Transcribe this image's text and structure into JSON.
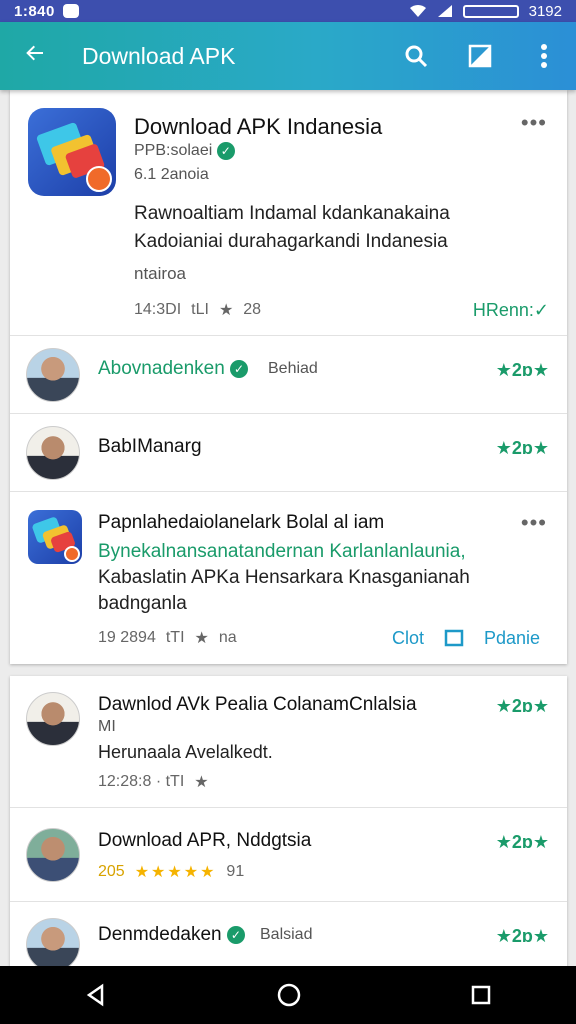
{
  "status": {
    "time": "1:840",
    "right_text": "3192"
  },
  "appbar": {
    "title": "Download APK"
  },
  "header_app": {
    "title": "Download APK Indanesia",
    "developer": "PPB:solaei",
    "version": "6.1 2anoia",
    "description": [
      "Rawnoaltiam Indamal kdankanakaina",
      "Kadoianiai durahagarkandi Indanesia"
    ],
    "tag": "ntairoa",
    "meta_date": "14:3DI",
    "meta_sep": "tLI",
    "meta_rating": "28",
    "action": "HRenn:✓"
  },
  "reviewers": [
    {
      "name": "Abovnadenken",
      "tag": "Behiad",
      "rating": "★2ɒ★"
    },
    {
      "name": "BabIManarg",
      "rating": "★2ɒ★"
    }
  ],
  "post": {
    "title": "Papnlahedaiolanelark Bolal al iam",
    "lines": [
      "Bynekalnansanatandernan Karlanlanlaunia,",
      "Kabaslatin APKa Hensarkara Knasganianah",
      "badnganla"
    ],
    "meta_date": "19 2894",
    "meta_sep": "tTI",
    "meta_extra": "na",
    "action1": "Clot",
    "action2": "Pdanie"
  },
  "list": [
    {
      "name": "Dawnlod AVk Pealia ColanamCnlalsia",
      "sub": "MI",
      "desc": "Herunaala Avelalkedt.",
      "meta": "12:28:8 · tTI",
      "rating": "★2ɒ★"
    },
    {
      "name": "Download APR, Nddgtsia",
      "score": "205",
      "stars": "★★★★★",
      "count": "91",
      "rating": "★2ɒ★"
    },
    {
      "name": "Denmdedaken",
      "tag": "Balsiad",
      "rating": "★2ɒ★"
    }
  ]
}
